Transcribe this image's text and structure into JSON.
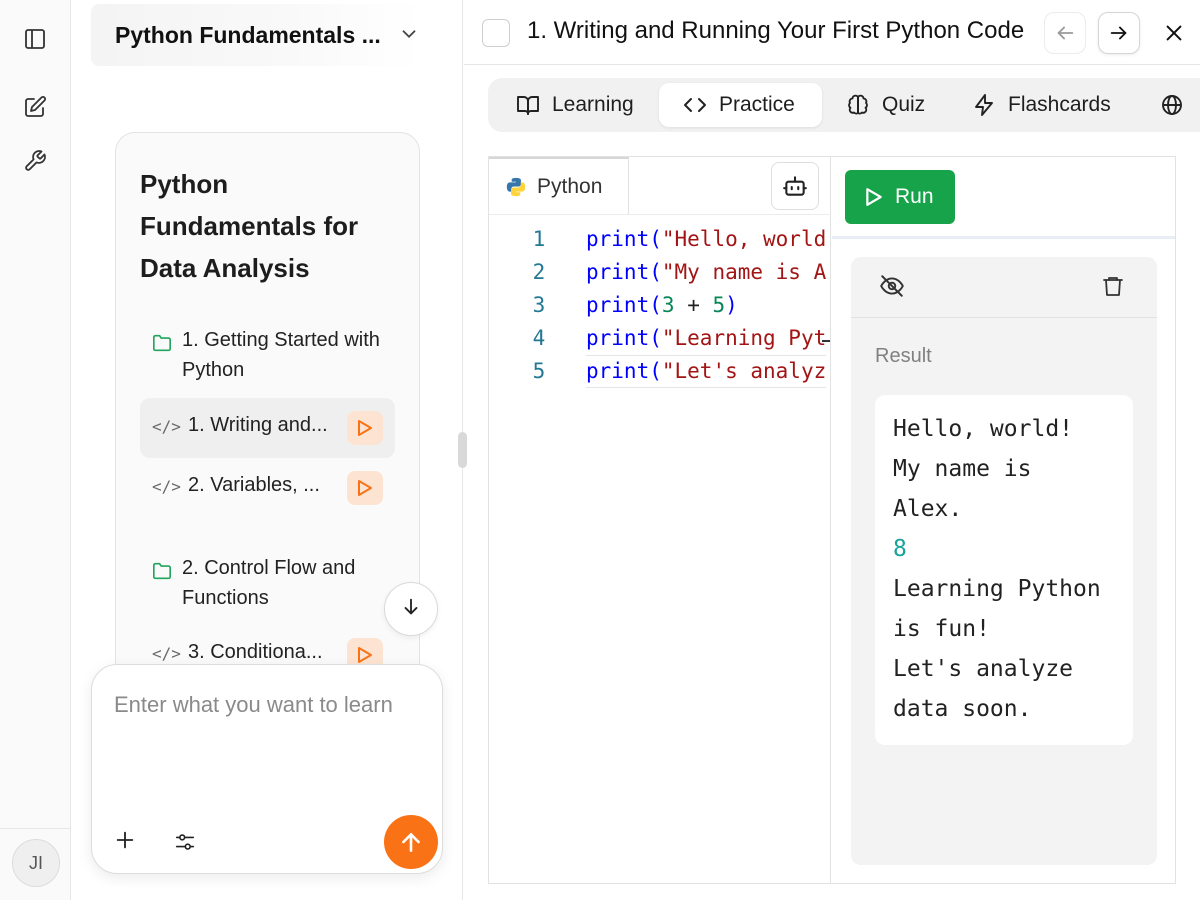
{
  "rail": {
    "avatar_initials": "JI"
  },
  "course": {
    "header_title": "Python Fundamentals ...",
    "card_title": "Python Fundamentals for Data Analysis",
    "sections": [
      {
        "label": "1. Getting Started with Python",
        "lessons": [
          {
            "label": "1. Writing and...",
            "active": true
          },
          {
            "label": "2. Variables, ...",
            "active": false
          }
        ]
      },
      {
        "label": "2. Control Flow and Functions",
        "lessons": [
          {
            "label": "3. Conditiona...",
            "active": false
          }
        ]
      }
    ],
    "prompt_placeholder": "Enter what you want to learn"
  },
  "main": {
    "lesson_title": "1. Writing and Running Your First Python Code",
    "tabs": [
      {
        "label": "Learning",
        "icon": "book-icon",
        "active": false
      },
      {
        "label": "Practice",
        "icon": "code-icon",
        "active": true
      },
      {
        "label": "Quiz",
        "icon": "brain-icon",
        "active": false
      },
      {
        "label": "Flashcards",
        "icon": "zap-icon",
        "active": false
      }
    ],
    "editor": {
      "language": "Python",
      "line_numbers": [
        "1",
        "2",
        "3",
        "4",
        "5"
      ],
      "lines": [
        "print(\"Hello, world!\")",
        "print(\"My name is Alex.\")",
        "print(3 + 5)",
        "print(\"Learning Python is fun!\")",
        "print(\"Let's analyze data soon.\")"
      ]
    },
    "run_label": "Run",
    "result_label": "Result",
    "output_lines": [
      {
        "text": "Hello, world!",
        "type": "str"
      },
      {
        "text": "My name is",
        "type": "str"
      },
      {
        "text": "Alex.",
        "type": "str"
      },
      {
        "text": "8",
        "type": "num"
      },
      {
        "text": "Learning Python",
        "type": "str"
      },
      {
        "text": "is fun!",
        "type": "str"
      },
      {
        "text": "Let's analyze",
        "type": "str"
      },
      {
        "text": "data soon.",
        "type": "str"
      }
    ]
  },
  "colors": {
    "accent_orange": "#f97316",
    "run_green": "#16a34a",
    "folder_green": "#22a45d",
    "output_number": "#1aa39b"
  }
}
